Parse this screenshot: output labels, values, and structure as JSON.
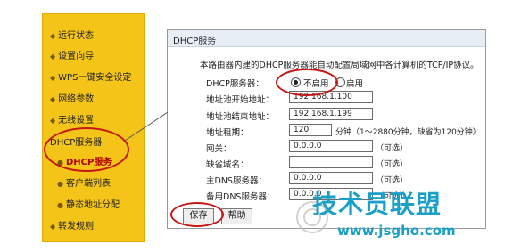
{
  "sidebar": {
    "items": [
      {
        "label": "运行状态"
      },
      {
        "label": "设置向导"
      },
      {
        "label": "WPS一键安全设定"
      },
      {
        "label": "网络参数"
      },
      {
        "label": "无线设置"
      },
      {
        "label": "DHCP服务器"
      },
      {
        "label": "DHCP服务"
      },
      {
        "label": "客户端列表"
      },
      {
        "label": "静态地址分配"
      },
      {
        "label": "转发规则"
      }
    ]
  },
  "panel": {
    "title": "DHCP服务",
    "description": "本路由器内建的DHCP服务器能自动配置局域网中各计算机的TCP/IP协议。",
    "dhcp_server": {
      "label": "DHCP服务器：",
      "option_off": "不启用",
      "option_on": "启用",
      "selected": "不启用"
    },
    "start_ip": {
      "label": "地址池开始地址：",
      "value": "192.168.1.100"
    },
    "end_ip": {
      "label": "地址池结束地址：",
      "value": "192.168.1.199"
    },
    "lease": {
      "label": "地址租期：",
      "value": "120",
      "note": "分钟（1～2880分钟，缺省为120分钟）"
    },
    "gateway": {
      "label": "网关：",
      "value": "0.0.0.0",
      "note": "（可选）"
    },
    "domain": {
      "label": "缺省域名：",
      "value": "",
      "note": "（可选）"
    },
    "dns_primary": {
      "label": "主DNS服务器：",
      "value": "0.0.0.0",
      "note": "（可选）"
    },
    "dns_backup": {
      "label": "备用DNS服务器：",
      "value": "0.0.0.0",
      "note": "（可选）"
    },
    "save_label": "保存",
    "help_label": "帮助"
  },
  "watermark": {
    "text": "技术员联盟",
    "url": "www.jsgho.com"
  },
  "colors": {
    "sidebar_bg": "#f4c418",
    "highlight_circle": "#c41818",
    "watermark": "#1a9fc7"
  }
}
